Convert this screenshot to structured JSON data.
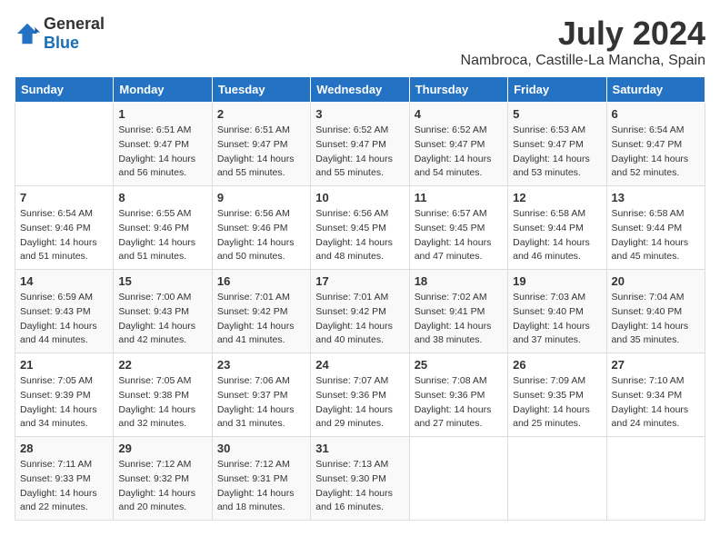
{
  "logo": {
    "general": "General",
    "blue": "Blue"
  },
  "title": "July 2024",
  "subtitle": "Nambroca, Castille-La Mancha, Spain",
  "days_header": [
    "Sunday",
    "Monday",
    "Tuesday",
    "Wednesday",
    "Thursday",
    "Friday",
    "Saturday"
  ],
  "weeks": [
    [
      {
        "day": "",
        "content": ""
      },
      {
        "day": "1",
        "content": "Sunrise: 6:51 AM\nSunset: 9:47 PM\nDaylight: 14 hours\nand 56 minutes."
      },
      {
        "day": "2",
        "content": "Sunrise: 6:51 AM\nSunset: 9:47 PM\nDaylight: 14 hours\nand 55 minutes."
      },
      {
        "day": "3",
        "content": "Sunrise: 6:52 AM\nSunset: 9:47 PM\nDaylight: 14 hours\nand 55 minutes."
      },
      {
        "day": "4",
        "content": "Sunrise: 6:52 AM\nSunset: 9:47 PM\nDaylight: 14 hours\nand 54 minutes."
      },
      {
        "day": "5",
        "content": "Sunrise: 6:53 AM\nSunset: 9:47 PM\nDaylight: 14 hours\nand 53 minutes."
      },
      {
        "day": "6",
        "content": "Sunrise: 6:54 AM\nSunset: 9:47 PM\nDaylight: 14 hours\nand 52 minutes."
      }
    ],
    [
      {
        "day": "7",
        "content": "Sunrise: 6:54 AM\nSunset: 9:46 PM\nDaylight: 14 hours\nand 51 minutes."
      },
      {
        "day": "8",
        "content": "Sunrise: 6:55 AM\nSunset: 9:46 PM\nDaylight: 14 hours\nand 51 minutes."
      },
      {
        "day": "9",
        "content": "Sunrise: 6:56 AM\nSunset: 9:46 PM\nDaylight: 14 hours\nand 50 minutes."
      },
      {
        "day": "10",
        "content": "Sunrise: 6:56 AM\nSunset: 9:45 PM\nDaylight: 14 hours\nand 48 minutes."
      },
      {
        "day": "11",
        "content": "Sunrise: 6:57 AM\nSunset: 9:45 PM\nDaylight: 14 hours\nand 47 minutes."
      },
      {
        "day": "12",
        "content": "Sunrise: 6:58 AM\nSunset: 9:44 PM\nDaylight: 14 hours\nand 46 minutes."
      },
      {
        "day": "13",
        "content": "Sunrise: 6:58 AM\nSunset: 9:44 PM\nDaylight: 14 hours\nand 45 minutes."
      }
    ],
    [
      {
        "day": "14",
        "content": "Sunrise: 6:59 AM\nSunset: 9:43 PM\nDaylight: 14 hours\nand 44 minutes."
      },
      {
        "day": "15",
        "content": "Sunrise: 7:00 AM\nSunset: 9:43 PM\nDaylight: 14 hours\nand 42 minutes."
      },
      {
        "day": "16",
        "content": "Sunrise: 7:01 AM\nSunset: 9:42 PM\nDaylight: 14 hours\nand 41 minutes."
      },
      {
        "day": "17",
        "content": "Sunrise: 7:01 AM\nSunset: 9:42 PM\nDaylight: 14 hours\nand 40 minutes."
      },
      {
        "day": "18",
        "content": "Sunrise: 7:02 AM\nSunset: 9:41 PM\nDaylight: 14 hours\nand 38 minutes."
      },
      {
        "day": "19",
        "content": "Sunrise: 7:03 AM\nSunset: 9:40 PM\nDaylight: 14 hours\nand 37 minutes."
      },
      {
        "day": "20",
        "content": "Sunrise: 7:04 AM\nSunset: 9:40 PM\nDaylight: 14 hours\nand 35 minutes."
      }
    ],
    [
      {
        "day": "21",
        "content": "Sunrise: 7:05 AM\nSunset: 9:39 PM\nDaylight: 14 hours\nand 34 minutes."
      },
      {
        "day": "22",
        "content": "Sunrise: 7:05 AM\nSunset: 9:38 PM\nDaylight: 14 hours\nand 32 minutes."
      },
      {
        "day": "23",
        "content": "Sunrise: 7:06 AM\nSunset: 9:37 PM\nDaylight: 14 hours\nand 31 minutes."
      },
      {
        "day": "24",
        "content": "Sunrise: 7:07 AM\nSunset: 9:36 PM\nDaylight: 14 hours\nand 29 minutes."
      },
      {
        "day": "25",
        "content": "Sunrise: 7:08 AM\nSunset: 9:36 PM\nDaylight: 14 hours\nand 27 minutes."
      },
      {
        "day": "26",
        "content": "Sunrise: 7:09 AM\nSunset: 9:35 PM\nDaylight: 14 hours\nand 25 minutes."
      },
      {
        "day": "27",
        "content": "Sunrise: 7:10 AM\nSunset: 9:34 PM\nDaylight: 14 hours\nand 24 minutes."
      }
    ],
    [
      {
        "day": "28",
        "content": "Sunrise: 7:11 AM\nSunset: 9:33 PM\nDaylight: 14 hours\nand 22 minutes."
      },
      {
        "day": "29",
        "content": "Sunrise: 7:12 AM\nSunset: 9:32 PM\nDaylight: 14 hours\nand 20 minutes."
      },
      {
        "day": "30",
        "content": "Sunrise: 7:12 AM\nSunset: 9:31 PM\nDaylight: 14 hours\nand 18 minutes."
      },
      {
        "day": "31",
        "content": "Sunrise: 7:13 AM\nSunset: 9:30 PM\nDaylight: 14 hours\nand 16 minutes."
      },
      {
        "day": "",
        "content": ""
      },
      {
        "day": "",
        "content": ""
      },
      {
        "day": "",
        "content": ""
      }
    ]
  ]
}
